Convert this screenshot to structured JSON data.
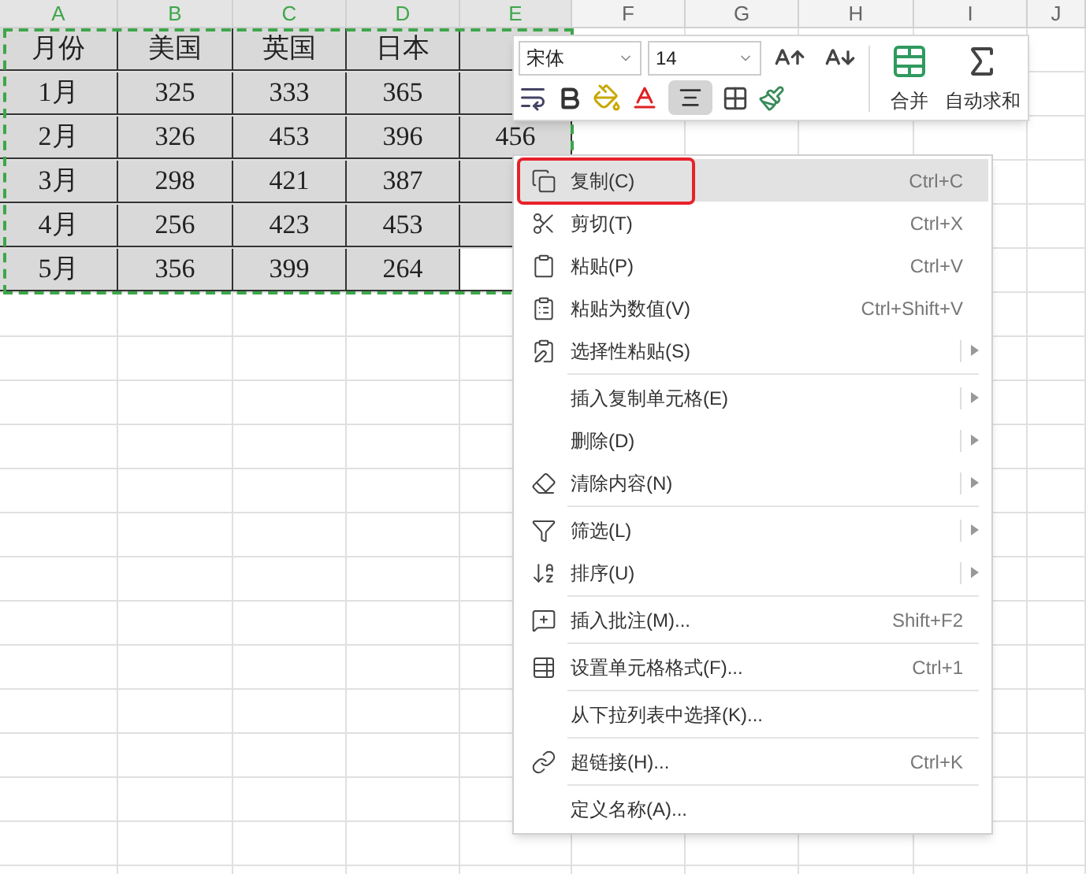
{
  "columns": [
    {
      "label": "A",
      "selected": true
    },
    {
      "label": "B",
      "selected": true
    },
    {
      "label": "C",
      "selected": true
    },
    {
      "label": "D",
      "selected": true
    },
    {
      "label": "E",
      "selected": true
    },
    {
      "label": "F",
      "selected": false
    },
    {
      "label": "G",
      "selected": false
    },
    {
      "label": "H",
      "selected": false
    },
    {
      "label": "I",
      "selected": false
    },
    {
      "label": "J",
      "selected": false
    }
  ],
  "table": {
    "rows": [
      {
        "cells": [
          {
            "text": "月份",
            "active": false
          },
          {
            "text": "美国",
            "active": false
          },
          {
            "text": "英国",
            "active": false
          },
          {
            "text": "日本",
            "active": false
          },
          {
            "active": false
          }
        ]
      },
      {
        "cells": [
          {
            "text": "1月",
            "active": false
          },
          {
            "text": "325",
            "active": false
          },
          {
            "text": "333",
            "active": false
          },
          {
            "text": "365",
            "active": false
          },
          {
            "active": false
          }
        ]
      },
      {
        "cells": [
          {
            "text": "2月",
            "active": false
          },
          {
            "text": "326",
            "active": false
          },
          {
            "text": "453",
            "active": false
          },
          {
            "text": "396",
            "active": false
          },
          {
            "text": "456",
            "active": false
          }
        ]
      },
      {
        "cells": [
          {
            "text": "3月",
            "active": false
          },
          {
            "text": "298",
            "active": false
          },
          {
            "text": "421",
            "active": false
          },
          {
            "text": "387",
            "active": false
          },
          {
            "active": false
          }
        ]
      },
      {
        "cells": [
          {
            "text": "4月",
            "active": false
          },
          {
            "text": "256",
            "active": false
          },
          {
            "text": "423",
            "active": false
          },
          {
            "text": "453",
            "active": false
          },
          {
            "active": false
          }
        ]
      },
      {
        "cells": [
          {
            "text": "5月",
            "active": false
          },
          {
            "text": "356",
            "active": false
          },
          {
            "text": "399",
            "active": false
          },
          {
            "text": "264",
            "active": false
          },
          {
            "active": true
          }
        ]
      }
    ]
  },
  "mini_toolbar": {
    "font": "宋体",
    "size": "14",
    "align_pressed": true,
    "merge": "合并",
    "autosum": "自动求和"
  },
  "context_menu": {
    "items": [
      {
        "kind": "copy",
        "label": "复制(C)",
        "shortcut": "Ctrl+C",
        "submenu": false,
        "highlighted": true
      },
      {
        "kind": "cut",
        "label": "剪切(T)",
        "shortcut": "Ctrl+X",
        "submenu": false,
        "highlighted": false
      },
      {
        "kind": "paste",
        "label": "粘贴(P)",
        "shortcut": "Ctrl+V",
        "submenu": false,
        "highlighted": false
      },
      {
        "kind": "paste-values",
        "label": "粘贴为数值(V)",
        "shortcut": "Ctrl+Shift+V",
        "submenu": false,
        "highlighted": false
      },
      {
        "kind": "paste-special",
        "label": "选择性粘贴(S)",
        "submenu": true,
        "highlighted": false
      },
      {
        "kind": "separator"
      },
      {
        "kind": "plain",
        "label": "插入复制单元格(E)",
        "submenu": true,
        "highlighted": false
      },
      {
        "kind": "plain",
        "label": "删除(D)",
        "submenu": true,
        "highlighted": false
      },
      {
        "kind": "clear",
        "label": "清除内容(N)",
        "submenu": true,
        "highlighted": false
      },
      {
        "kind": "separator"
      },
      {
        "kind": "filter",
        "label": "筛选(L)",
        "submenu": true,
        "highlighted": false
      },
      {
        "kind": "sort",
        "label": "排序(U)",
        "submenu": true,
        "highlighted": false
      },
      {
        "kind": "separator"
      },
      {
        "kind": "comment",
        "label": "插入批注(M)...",
        "shortcut": "Shift+F2",
        "submenu": false,
        "highlighted": false
      },
      {
        "kind": "separator"
      },
      {
        "kind": "format",
        "label": "设置单元格格式(F)...",
        "shortcut": "Ctrl+1",
        "submenu": false,
        "highlighted": false
      },
      {
        "kind": "separator"
      },
      {
        "kind": "plain",
        "label": "从下拉列表中选择(K)...",
        "submenu": false,
        "highlighted": false
      },
      {
        "kind": "separator"
      },
      {
        "kind": "link",
        "label": "超链接(H)...",
        "shortcut": "Ctrl+K",
        "submenu": false,
        "highlighted": false
      },
      {
        "kind": "separator"
      },
      {
        "kind": "plain",
        "label": "定义名称(A)...",
        "submenu": false,
        "highlighted": false
      }
    ]
  }
}
